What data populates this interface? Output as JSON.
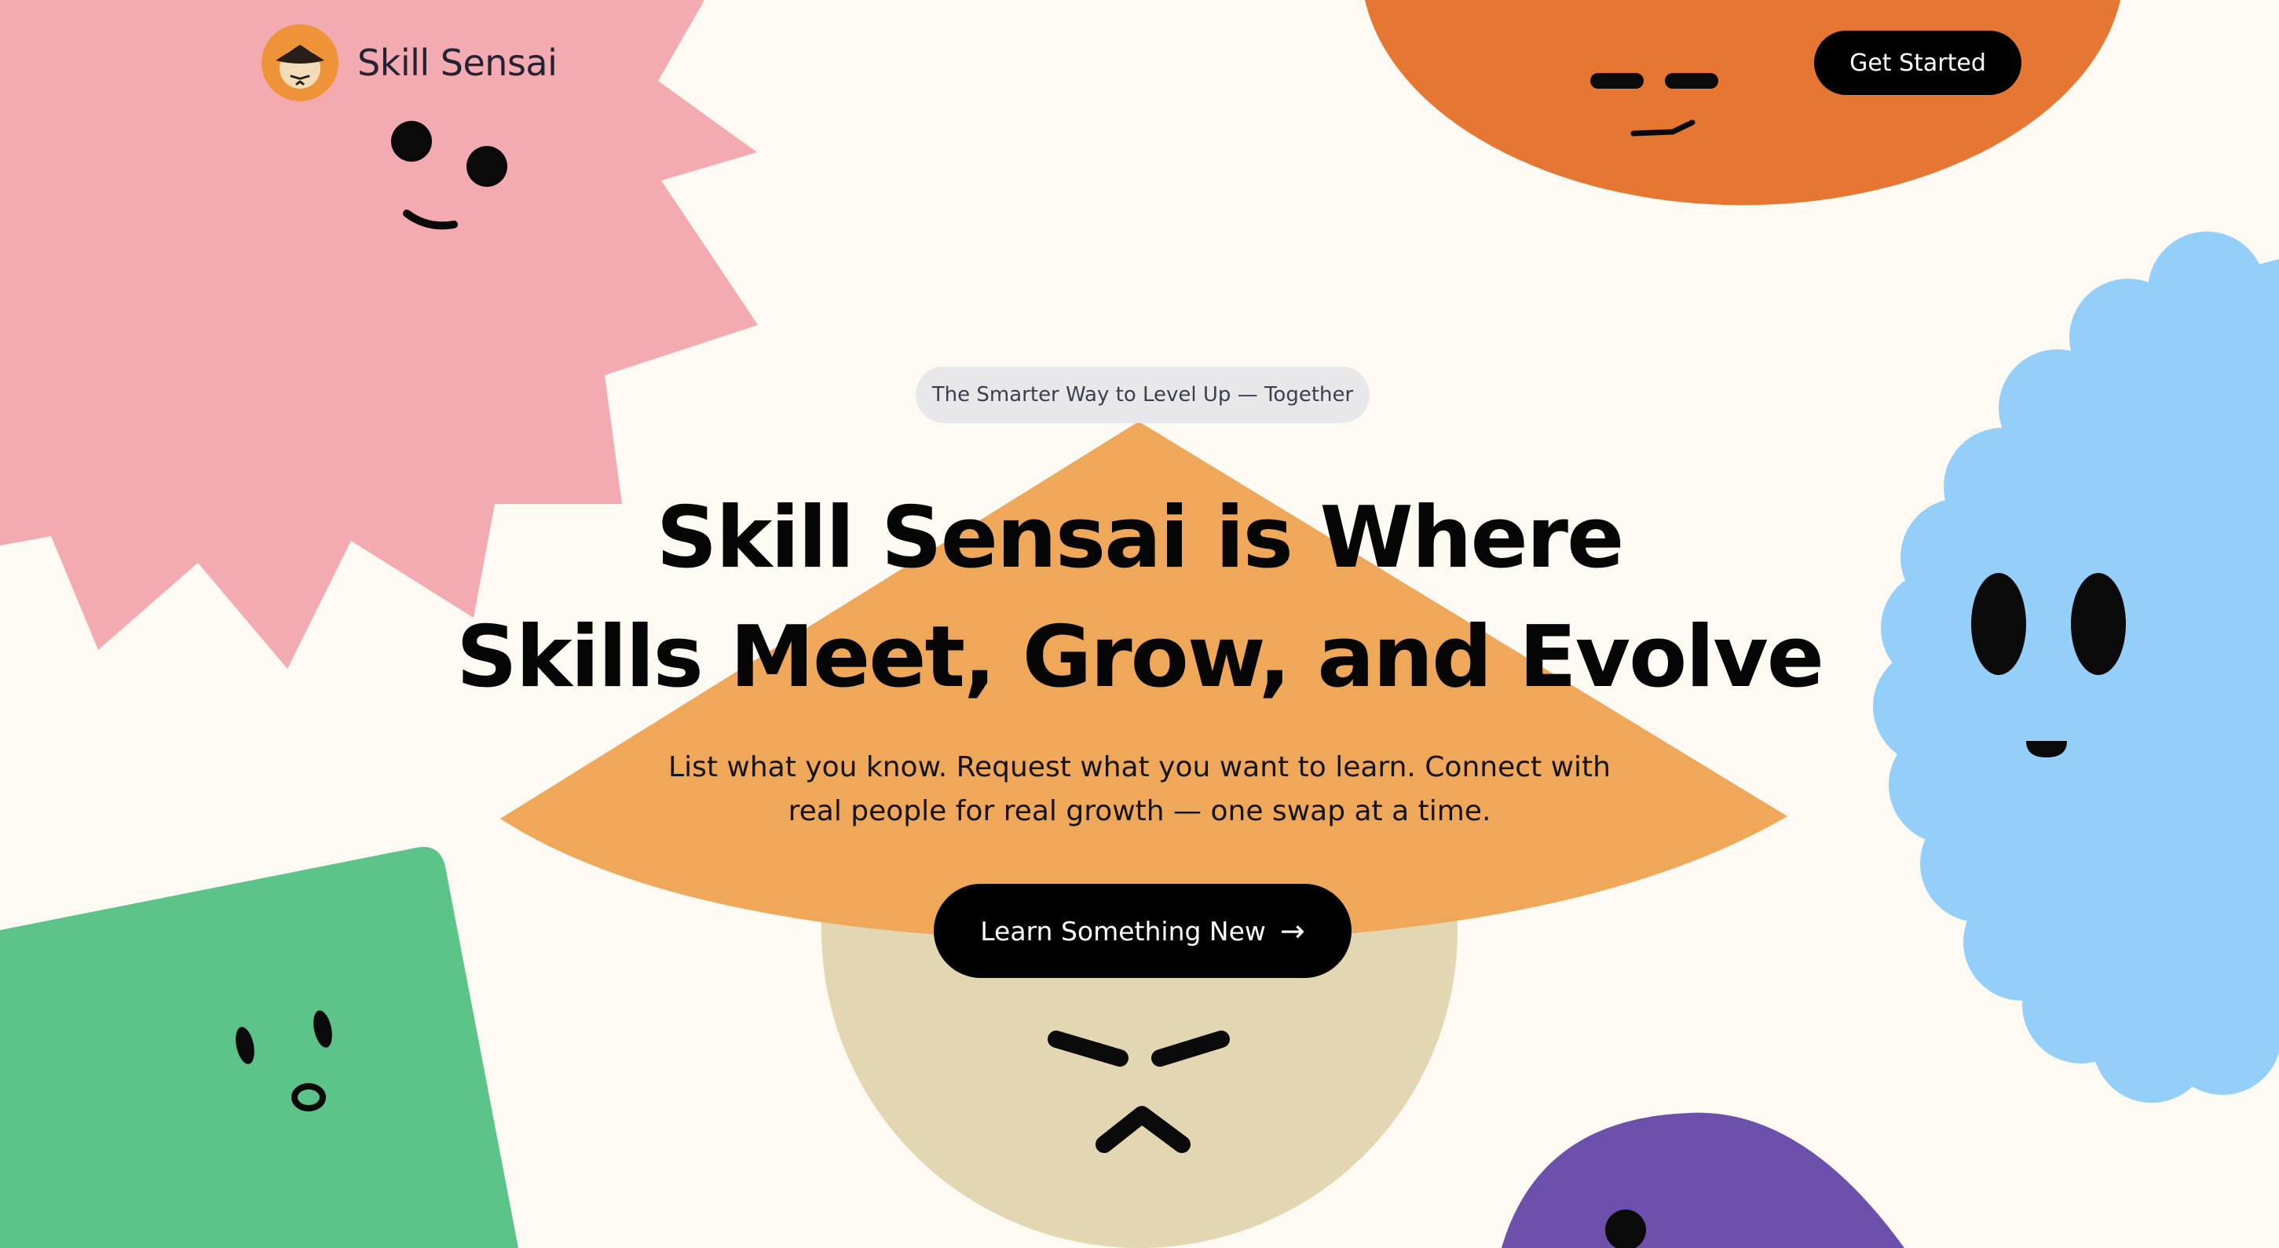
{
  "header": {
    "brand_name": "Skill Sensai",
    "logo_icon": "sensai-hat-face-icon",
    "cta_label": "Get Started"
  },
  "hero": {
    "badge_text": "The Smarter Way to Level Up — Together",
    "title_line_1": "Skill Sensai is Where",
    "title_line_2": "Skills Meet, Grow, and Evolve",
    "subtitle_line_1": "List what you know. Request what you want to learn. Connect with",
    "subtitle_line_2": "real people for real growth — one swap at a time.",
    "cta_label": "Learn Something New",
    "cta_arrow": "→"
  },
  "characters": [
    {
      "name": "pink-spiky-character",
      "color": "#F3AAB0"
    },
    {
      "name": "orange-sun-character",
      "color": "#E57733"
    },
    {
      "name": "blue-cloud-character",
      "color": "#94CFFA"
    },
    {
      "name": "green-square-character",
      "color": "#5CC389"
    },
    {
      "name": "sensai-hat-character",
      "color": "#EFA75A"
    },
    {
      "name": "sensai-face-character",
      "color": "#E2D7B2"
    },
    {
      "name": "purple-blob-character",
      "color": "#6C50AC"
    }
  ],
  "colors": {
    "background": "#FDFAF3",
    "button": "#000000",
    "badge": "#E8E8EA",
    "text": "#050505"
  }
}
